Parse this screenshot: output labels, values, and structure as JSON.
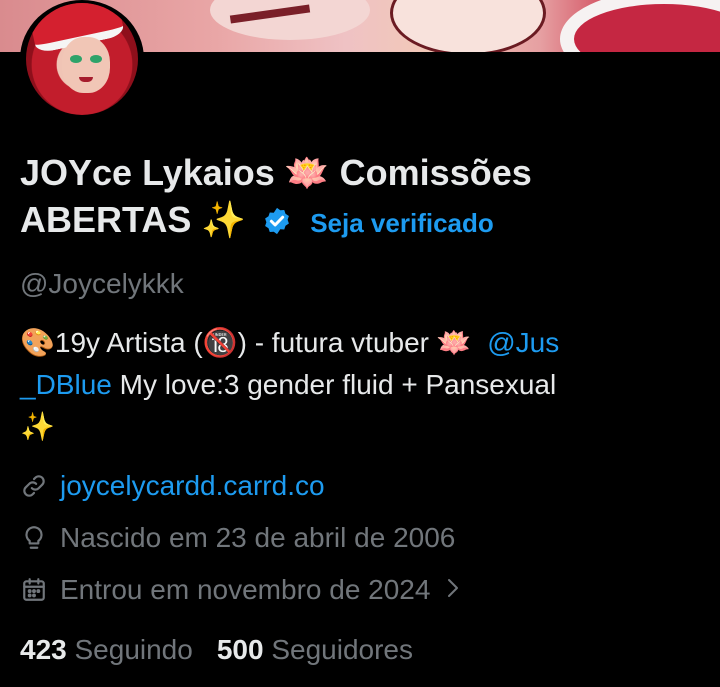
{
  "profile": {
    "name_line1": "JOYce Lykaios",
    "name_emoji1": "🪷",
    "name_word2": "Comissões",
    "name_line2": "ABERTAS",
    "name_emoji2": "✨",
    "verify_label": "Seja verificado",
    "handle": "@Joycelykkk"
  },
  "bio": {
    "part1_emoji": "🎨",
    "part1": "19y  Artista (",
    "nsfw_emoji": "🔞",
    "part2": ") - futura vtuber ",
    "lotus_emoji": "🪷",
    "mention": "@Jus_DBlue",
    "mention_line1": "@Jus",
    "mention_line2": "_DBlue",
    "part3": " My love:3 gender fluid + Pansexual",
    "sparkle_emoji": "✨"
  },
  "meta": {
    "website": "joycelycardd.carrd.co",
    "birth": "Nascido em 23 de abril de 2006",
    "joined": "Entrou em novembro de 2024"
  },
  "stats": {
    "following_count": "423",
    "following_label": "Seguindo",
    "followers_count": "500",
    "followers_label": "Seguidores"
  },
  "colors": {
    "accent": "#1d9bf0",
    "secondary_text": "#71767b",
    "primary_text": "#e7e9ea",
    "background": "#000000"
  },
  "icons": [
    "verified-badge-icon",
    "link-icon",
    "location-pin-icon",
    "calendar-icon",
    "chevron-right-icon"
  ]
}
